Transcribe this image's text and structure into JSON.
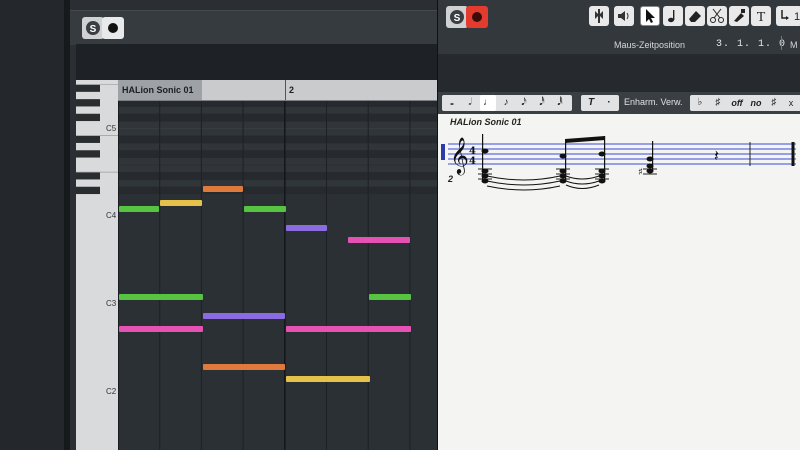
{
  "key_editor": {
    "track_name": "HALion Sonic 01",
    "ruler_marker": "2",
    "key_labels": {
      "c5": "C5",
      "c4": "C4",
      "c3": "C3",
      "c2": "C2"
    },
    "solo_label": "S"
  },
  "score_editor": {
    "solo_label": "S",
    "mouse_position_label": "Maus-Zeitposition",
    "mouse_position_value": "3. 1. 1.   0",
    "right_cut_text": "M",
    "enharm_label": "Enharm. Verw.",
    "text_button": "T",
    "dot_button": "·",
    "enharm_buttons": [
      "♭",
      "♯",
      "off",
      "no",
      "♯",
      "x"
    ],
    "note_values": [
      "𝅝",
      "𝅗𝅥",
      "♩",
      "♪",
      "𝅘𝅥𝅯",
      "𝅘𝅥𝅰",
      "𝅘𝅥𝅱"
    ],
    "track_name": "HALion Sonic 01",
    "bar_number": "2",
    "time_signature": "4/4"
  },
  "toolbar_icons": [
    "auto-scroll-icon",
    "speaker-icon",
    "arrow-icon",
    "note-icon",
    "eraser-icon",
    "scissors-icon",
    "glue-icon",
    "text-icon"
  ],
  "colors": {
    "green": "#56c341",
    "yellow": "#e6c24a",
    "orange": "#e07a3c",
    "purple": "#8a6be0",
    "pink": "#e552b4",
    "record_red": "#e43b2f"
  }
}
